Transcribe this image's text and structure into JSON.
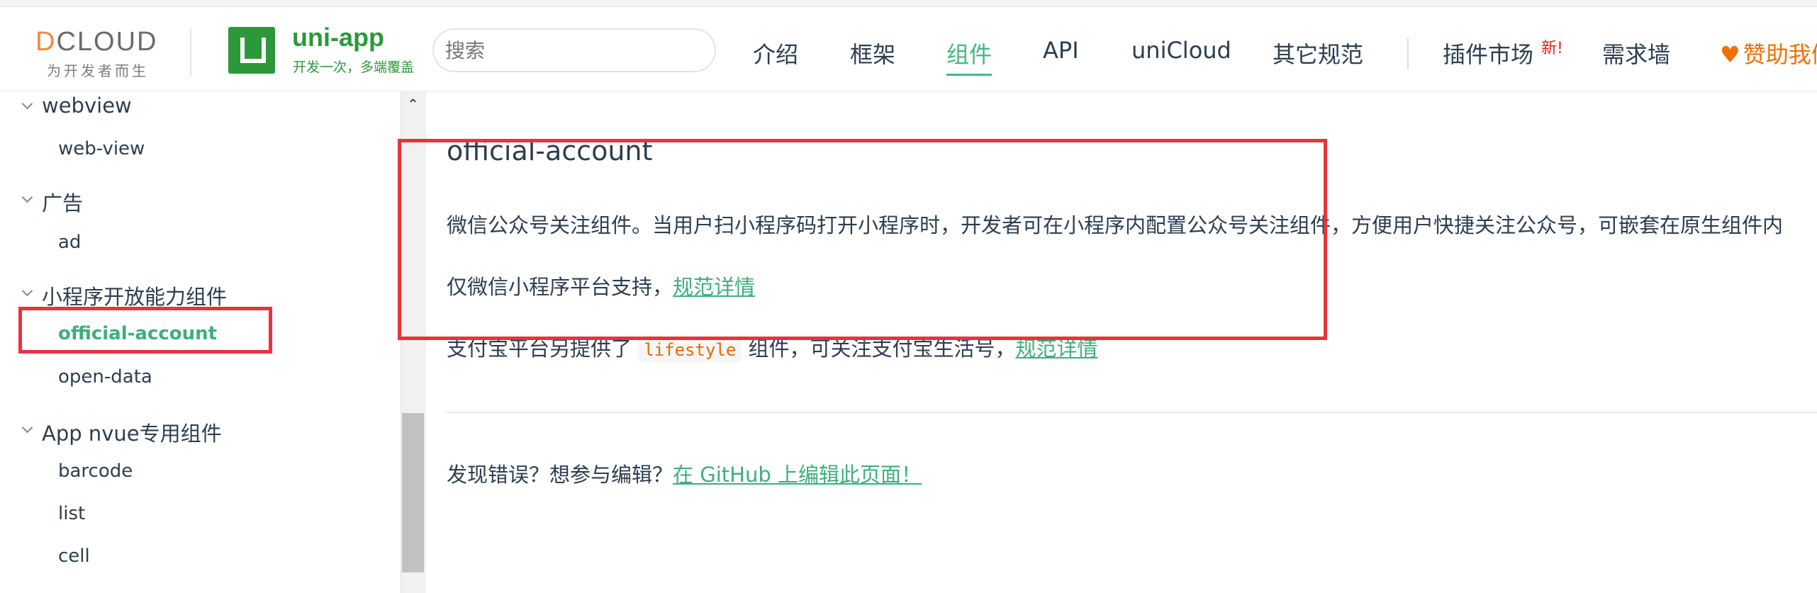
{
  "header": {
    "dcloud_tagline": "为开发者而生",
    "app_name": "uni-app",
    "app_slogan": "开发一次，多端覆盖",
    "search_placeholder": "搜索",
    "nav": [
      "介绍",
      "框架",
      "组件",
      "API",
      "uniCloud",
      "其它规范",
      "插件市场",
      "需求墙"
    ],
    "nav_active": "组件",
    "new_badge": "新!",
    "sponsor": "赞助我们"
  },
  "sidebar": {
    "groups": [
      {
        "title": "webview",
        "items": [
          "web-view"
        ]
      },
      {
        "title": "广告",
        "items": [
          "ad"
        ]
      },
      {
        "title": "小程序开放能力组件",
        "items": [
          "official-account",
          "open-data"
        ]
      },
      {
        "title": "App nvue专用组件",
        "items": [
          "barcode",
          "list",
          "cell"
        ]
      }
    ],
    "active_item": "official-account"
  },
  "content": {
    "title": "official-account",
    "para1": "微信公众号关注组件。当用户扫小程序码打开小程序时，开发者可在小程序内配置公众号关注组件，方便用户快捷关注公众号，可嵌套在原生组件内",
    "para2_prefix": "仅微信小程序平台支持，",
    "para2_link": "规范详情",
    "para3_prefix": "支付宝平台另提供了",
    "para3_code": "lifestyle",
    "para3_mid": "组件，可关注支付宝生活号，",
    "para3_link": "规范详情",
    "edit_prefix": "发现错误？想参与编辑？",
    "edit_link": "在 GitHub 上编辑此页面！"
  },
  "colors": {
    "accent": "#3eaf7c",
    "brand_green": "#2b9939",
    "highlight_border": "#e8333c",
    "sponsor_orange": "#f07000"
  }
}
